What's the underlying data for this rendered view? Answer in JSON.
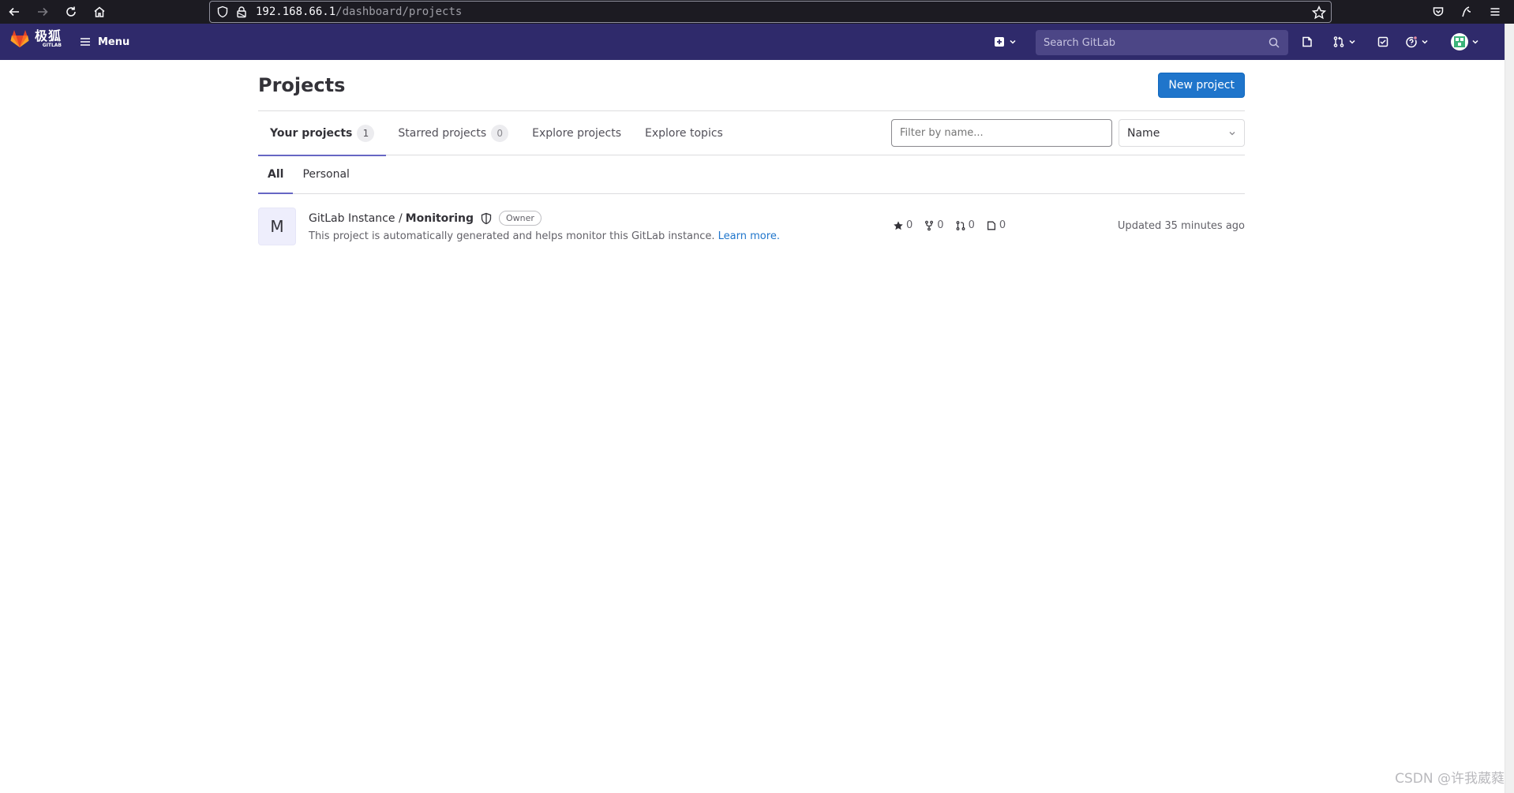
{
  "browser": {
    "url_host": "192.168.66.1",
    "url_path": "/dashboard/projects"
  },
  "topnav": {
    "logo_text": "极狐",
    "logo_subtext": "GITLAB",
    "menu_label": "Menu",
    "search_placeholder": "Search GitLab"
  },
  "page": {
    "title": "Projects",
    "new_project_label": "New project"
  },
  "tabs": [
    {
      "label": "Your projects",
      "count": "1"
    },
    {
      "label": "Starred projects",
      "count": "0"
    },
    {
      "label": "Explore projects"
    },
    {
      "label": "Explore topics"
    }
  ],
  "filter": {
    "placeholder": "Filter by name...",
    "sort_value": "Name"
  },
  "subtabs": [
    {
      "label": "All"
    },
    {
      "label": "Personal"
    }
  ],
  "projects": [
    {
      "avatar_letter": "M",
      "namespace": "GitLab Instance /",
      "name": "Monitoring",
      "role": "Owner",
      "description": "This project is automatically generated and helps monitor this GitLab instance.",
      "learn_more": "Learn more.",
      "stars": "0",
      "forks": "0",
      "merge_requests": "0",
      "issues": "0",
      "updated": "Updated 35 minutes ago"
    }
  ],
  "watermark": "CSDN @许我葳蕤",
  "colors": {
    "nav_bg": "#2f2a6b",
    "primary": "#1f75cb",
    "active_tab": "#6666c4"
  },
  "icons": [
    "back-icon",
    "forward-icon",
    "reload-icon",
    "home-icon",
    "shield-icon",
    "lock-icon",
    "star-icon",
    "pocket-icon",
    "extension-icon",
    "hamburger-icon",
    "gitlab-logo-icon",
    "plus-square-icon",
    "search-icon",
    "issues-icon",
    "merge-request-icon",
    "todo-icon",
    "help-icon",
    "avatar-icon",
    "chevron-down-icon",
    "fork-icon"
  ]
}
